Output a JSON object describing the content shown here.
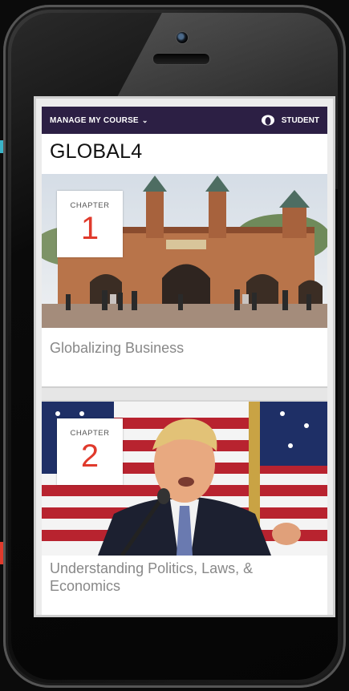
{
  "nav": {
    "manage_label": "MANAGE MY COURSE",
    "student_label": "STUDENT"
  },
  "course": {
    "title": "GLOBAL4"
  },
  "chapters": [
    {
      "label": "CHAPTER",
      "number": "1",
      "title": "Globalizing Business"
    },
    {
      "label": "CHAPTER",
      "number": "2",
      "title": "Understanding Politics, Laws, & Economics"
    }
  ],
  "colors": {
    "topbar": "#2c1f44",
    "chapter_number": "#e03a2c",
    "arrow": "#3ab3c8"
  },
  "icons": {
    "chevron": "chevron-down-icon",
    "student": "student-avatar-icon",
    "arrow": "pointer-arrow-icon"
  }
}
